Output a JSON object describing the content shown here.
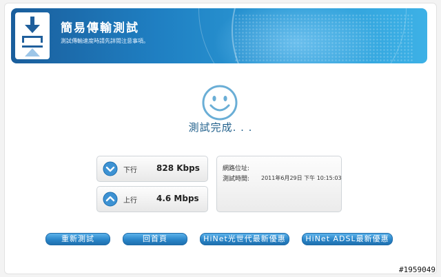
{
  "banner": {
    "title": "簡易傳輸測試",
    "subtitle": "測試傳輸速度時請先詳閱注意事項。"
  },
  "status": {
    "text": "測試完成. . ."
  },
  "speeds": {
    "download": {
      "label": "下行",
      "value": "828 Kbps"
    },
    "upload": {
      "label": "上行",
      "value": "4.6 Mbps"
    }
  },
  "info": {
    "ip_label": "網路位址:",
    "ip_value": "",
    "time_label": "測試時間:",
    "time_value": "2011年6月29日 下午 10:15:03"
  },
  "buttons": {
    "retest": "重新測試",
    "home": "回首頁",
    "hinet_fiber": "HiNet光世代最新優惠",
    "hinet_adsl": "HiNet ADSL最新優惠"
  },
  "watermark": {
    "text": "#1959049"
  },
  "colors": {
    "accent": "#2a86c9",
    "status_text": "#1f5f8b",
    "smiley": "#6aaed6"
  },
  "icons": {
    "banner": "transfer-icon",
    "status": "smiley-icon",
    "down": "arrow-down-icon",
    "up": "arrow-up-icon"
  }
}
